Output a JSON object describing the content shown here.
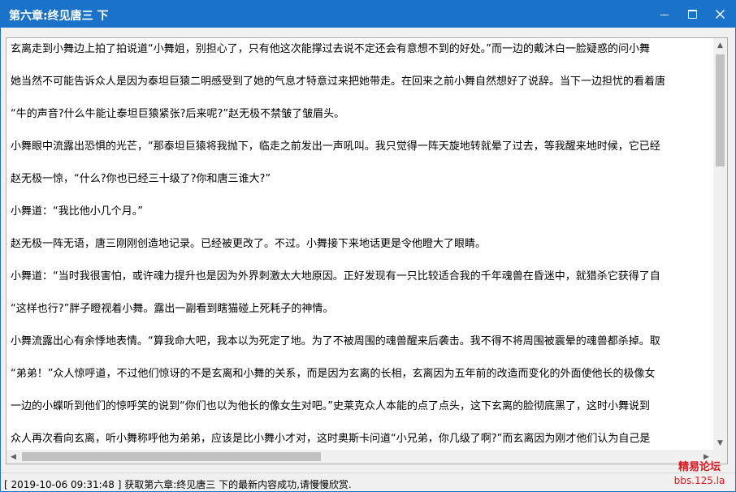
{
  "window": {
    "title": "第六章:终见唐三 下"
  },
  "content": {
    "paragraphs": [
      "玄离走到小舞边上拍了拍说道“小舞姐，别担心了，只有他这次能撑过去说不定还会有意想不到的好处。”而一边的戴沐白一脸疑惑的问小舞",
      "她当然不可能告诉众人是因为泰坦巨猿二明感受到了她的气息才特意过来把她带走。在回来之前小舞自然想好了说辞。当下一边担忧的看着唐",
      "“牛的声音?什么牛能让泰坦巨猿紧张?后来呢?”赵无极不禁皱了皱眉头。",
      "小舞眼中流露出恐惧的光芒，“那泰坦巨猿将我抛下，临走之前发出一声吼叫。我只觉得一阵天旋地转就晕了过去，等我醒来地时候，它已经",
      "赵无极一惊，“什么?你也已经三十级了?你和唐三谁大?”",
      "小舞道：“我比他小几个月。”",
      "赵无极一阵无语，唐三刚刚创造地记录。已经被更改了。不过。小舞接下来地话更是令他瞪大了眼睛。",
      "小舞道：“当时我很害怕，或许魂力提升也是因为外界刺激太大地原因。正好发现有一只比较适合我的千年魂兽在昏迷中，就猎杀它获得了自",
      "“这样也行?”胖子瞪视着小舞。露出一副看到瞎猫碰上死耗子的神情。",
      "小舞流露出心有余悸地表情。“算我命大吧，我本以为死定了地。为了不被周围的魂兽醒来后袭击。我不得不将周围被震晕的魂兽都杀掉。取",
      "“弟弟！”众人惊呼道，不过他们惊讶的不是玄离和小舞的关系，而是因为玄离的长相，玄离因为五年前的改造而变化的外面使他长的极像女",
      "一边的小蝶听到他们的惊呼笑的说到“你们也以为他长的像女生对吧。”史莱克众人本能的点了点头，这下玄离的脸彻底黑了，这时小舞说到",
      "众人再次看向玄离，听小舞称呼他为弟弟，应该是比小舞小才对，这时奥斯卡问道“小兄弟，你几级了啊?”而玄离因为刚才他们认为自己是"
    ]
  },
  "status": {
    "text": "[ 2019-10-06 09:31:48 ] 获取第六章:终见唐三 下的最新内容成功,请慢慢欣赏."
  },
  "watermark": {
    "line1": "精易论坛",
    "line2": "bbs.125.la"
  },
  "icons": {
    "minimize": "minimize-icon",
    "maximize": "maximize-icon",
    "close": "close-icon",
    "scroll_up": "arrow-up-icon",
    "scroll_down": "arrow-down-icon",
    "scroll_left": "arrow-left-icon",
    "scroll_right": "arrow-right-icon"
  },
  "colors": {
    "titlebar": "#1a73c8",
    "watermark": "#e0161c"
  }
}
